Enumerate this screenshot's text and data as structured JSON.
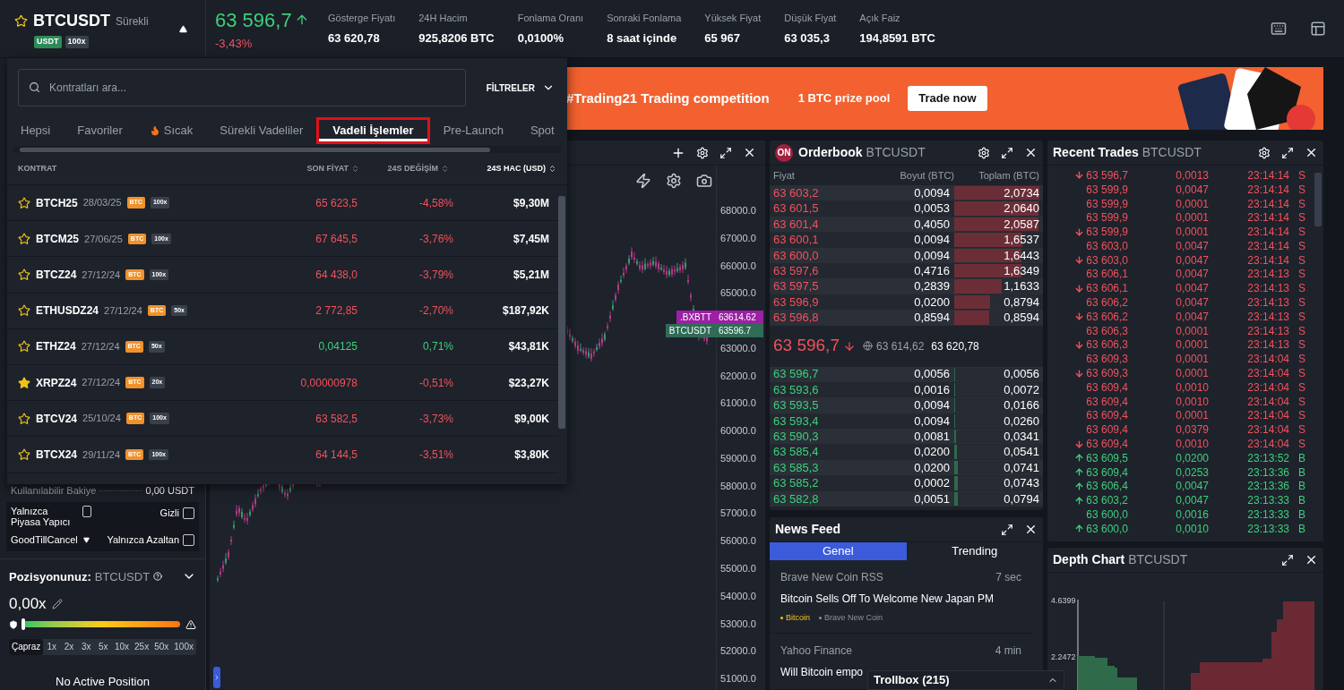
{
  "header": {
    "symbol": "BTCUSDT",
    "type": "Sürekli",
    "favorite": false,
    "tags": [
      {
        "label": "USDT",
        "kind": "quote"
      },
      {
        "label": "100x",
        "kind": "leverage"
      }
    ],
    "last_price": "63 596,7",
    "price_up": true,
    "change": "-3,43%",
    "change_positive": false,
    "stats": [
      {
        "label": "Gösterge Fiyatı",
        "value": "63 620,78"
      },
      {
        "label": "24H Hacim",
        "value": "925,8206 BTC"
      },
      {
        "label": "Fonlama Oranı",
        "value": "0,0100%"
      },
      {
        "label": "Sonraki Fonlama",
        "value": "8 saat içinde"
      },
      {
        "label": "Yüksek Fiyat",
        "value": "65 967"
      },
      {
        "label": "Düşük Fiyat",
        "value": "63 035,3"
      },
      {
        "label": "Açık Faiz",
        "value": "194,8591 BTC"
      }
    ]
  },
  "contract_menu": {
    "search": {
      "placeholder": "Kontratları ara..."
    },
    "filter_label": "FİLTRELER",
    "tabs": [
      {
        "label": "Hepsi",
        "selected": false,
        "hot": false
      },
      {
        "label": "Favoriler",
        "selected": false,
        "hot": false
      },
      {
        "label": "Sıcak",
        "selected": false,
        "hot": true
      },
      {
        "label": "Sürekli Vadeliler",
        "selected": false,
        "hot": false
      },
      {
        "label": "Vadeli İşlemler",
        "selected": true,
        "hot": false
      },
      {
        "label": "Pre-Launch",
        "selected": false,
        "hot": false
      },
      {
        "label": "Spot",
        "selected": false,
        "hot": false
      }
    ],
    "columns": [
      {
        "label": "KONTRAT",
        "sortable": false,
        "active": false
      },
      {
        "label": "SON FİYAT",
        "sortable": true,
        "active": false
      },
      {
        "label": "24S DEĞİŞİM",
        "sortable": true,
        "active": false
      },
      {
        "label": "24S HAC (USD)",
        "sortable": true,
        "active": true
      }
    ],
    "rows": [
      {
        "symbol": "BTCH25",
        "date": "28/03/25",
        "tags": [
          "BTC",
          "100x"
        ],
        "favorite": false,
        "price": "65 623,5",
        "change": "-4,58%",
        "volume": "$9,30M",
        "positive": false
      },
      {
        "symbol": "BTCM25",
        "date": "27/06/25",
        "tags": [
          "BTC",
          "100x"
        ],
        "favorite": false,
        "price": "67 645,5",
        "change": "-3,76%",
        "volume": "$7,45M",
        "positive": false
      },
      {
        "symbol": "BTCZ24",
        "date": "27/12/24",
        "tags": [
          "BTC",
          "100x"
        ],
        "favorite": false,
        "price": "64 438,0",
        "change": "-3,79%",
        "volume": "$5,21M",
        "positive": false
      },
      {
        "symbol": "ETHUSDZ24",
        "date": "27/12/24",
        "tags": [
          "BTC",
          "50x"
        ],
        "favorite": false,
        "price": "2 772,85",
        "change": "-2,70%",
        "volume": "$187,92K",
        "positive": false
      },
      {
        "symbol": "ETHZ24",
        "date": "27/12/24",
        "tags": [
          "BTC",
          "50x"
        ],
        "favorite": false,
        "price": "0,04125",
        "change": "0,71%",
        "volume": "$43,81K",
        "positive": true
      },
      {
        "symbol": "XRPZ24",
        "date": "27/12/24",
        "tags": [
          "BTC",
          "20x"
        ],
        "favorite": true,
        "price": "0,00000978",
        "change": "-0,51%",
        "volume": "$23,27K",
        "positive": false
      },
      {
        "symbol": "BTCV24",
        "date": "25/10/24",
        "tags": [
          "BTC",
          "100x"
        ],
        "favorite": false,
        "price": "63 582,5",
        "change": "-3,73%",
        "volume": "$9,00K",
        "positive": false
      },
      {
        "symbol": "BTCX24",
        "date": "29/11/24",
        "tags": [
          "BTC",
          "100x"
        ],
        "favorite": false,
        "price": "64 144,5",
        "change": "-3,51%",
        "volume": "$3,80K",
        "positive": false
      }
    ]
  },
  "banner": {
    "title": "#Trading21 Trading competition",
    "subtitle": "1 BTC prize pool",
    "button": "Trade now"
  },
  "order_form": {
    "balance_label": "Kullanılabilir Bakiye",
    "balance_value": "0,00 USDT",
    "time_in_force": "GoodTillCancel",
    "options": [
      {
        "label": "Yalnızca Piyasa Yapıcı",
        "checked": false
      },
      {
        "label": "Gizli",
        "checked": false
      },
      {
        "label": "Yalnızca Azaltan",
        "checked": false
      }
    ]
  },
  "position": {
    "title": "Pozisyonunuz:",
    "symbol": "BTCUSDT",
    "leverage": "0,00x",
    "level": 0,
    "status": "No Active Position",
    "leverage_options": [
      {
        "label": "Çapraz",
        "selected": true
      },
      {
        "label": "1x",
        "selected": false
      },
      {
        "label": "2x",
        "selected": false
      },
      {
        "label": "3x",
        "selected": false
      },
      {
        "label": "5x",
        "selected": false
      },
      {
        "label": "10x",
        "selected": false
      },
      {
        "label": "25x",
        "selected": false
      },
      {
        "label": "50x",
        "selected": false
      },
      {
        "label": "100x",
        "selected": false
      }
    ]
  },
  "chart": {
    "y_axis": [
      "68000.0",
      "67000.0",
      "66000.0",
      "65000.0",
      "63000.0",
      "62000.0",
      "61000.0",
      "60000.0",
      "59000.0",
      "58000.0",
      "57000.0",
      "56000.0",
      "55000.0",
      "54000.0",
      "53000.0",
      "52000.0",
      "51000.0"
    ],
    "price_tags": [
      {
        "symbol": ".BXBTT",
        "price": "63614.62",
        "color": "#9c1fa5"
      },
      {
        "symbol": "BTCUSDT",
        "price": "63596.7",
        "color": "#2f6b55"
      }
    ]
  },
  "orderbook": {
    "badge": "ON",
    "title": "Orderbook",
    "symbol": "BTCUSDT",
    "columns": [
      "Fiyat",
      "Boyut (BTC)",
      "Toplam (BTC)"
    ],
    "asks": [
      {
        "price": "63 603,2",
        "size": "0,0094",
        "total": "2,0734",
        "level": 1
      },
      {
        "price": "63 601,5",
        "size": "0,0053",
        "total": "2,0640",
        "level": 0.99
      },
      {
        "price": "63 601,4",
        "size": "0,4050",
        "total": "2,0587",
        "level": 0.99
      },
      {
        "price": "63 600,1",
        "size": "0,0094",
        "total": "1,6537",
        "level": 0.8
      },
      {
        "price": "63 600,0",
        "size": "0,0094",
        "total": "1,6443",
        "level": 0.79
      },
      {
        "price": "63 597,6",
        "size": "0,4716",
        "total": "1,6349",
        "level": 0.79
      },
      {
        "price": "63 597,5",
        "size": "0,2839",
        "total": "1,1633",
        "level": 0.56
      },
      {
        "price": "63 596,9",
        "size": "0,0200",
        "total": "0,8794",
        "level": 0.42
      },
      {
        "price": "63 596,8",
        "size": "0,8594",
        "total": "0,8594",
        "level": 0.41
      }
    ],
    "mid": {
      "price": "63 596,7",
      "price_up": false,
      "index": "63 614,62",
      "mark": "63 620,78"
    },
    "bids": [
      {
        "price": "63 596,7",
        "size": "0,0056",
        "total": "0,0056",
        "level": 0.01
      },
      {
        "price": "63 593,6",
        "size": "0,0016",
        "total": "0,0072",
        "level": 0.01
      },
      {
        "price": "63 593,5",
        "size": "0,0094",
        "total": "0,0166",
        "level": 0.01
      },
      {
        "price": "63 593,4",
        "size": "0,0094",
        "total": "0,0260",
        "level": 0.01
      },
      {
        "price": "63 590,3",
        "size": "0,0081",
        "total": "0,0341",
        "level": 0.02
      },
      {
        "price": "63 585,4",
        "size": "0,0200",
        "total": "0,0541",
        "level": 0.03
      },
      {
        "price": "63 585,3",
        "size": "0,0200",
        "total": "0,0741",
        "level": 0.04
      },
      {
        "price": "63 585,2",
        "size": "0,0002",
        "total": "0,0743",
        "level": 0.04
      },
      {
        "price": "63 582,8",
        "size": "0,0051",
        "total": "0,0794",
        "level": 0.04
      }
    ]
  },
  "recent_trades": {
    "title": "Recent Trades",
    "symbol": "BTCUSDT",
    "rows": [
      {
        "price": "63 596,7",
        "size": "0,0013",
        "time": "23:14:14",
        "side": "S",
        "buy": false,
        "arrow": true
      },
      {
        "price": "63 599,9",
        "size": "0,0047",
        "time": "23:14:14",
        "side": "S",
        "buy": false,
        "arrow": false
      },
      {
        "price": "63 599,9",
        "size": "0,0001",
        "time": "23:14:14",
        "side": "S",
        "buy": false,
        "arrow": false
      },
      {
        "price": "63 599,9",
        "size": "0,0001",
        "time": "23:14:14",
        "side": "S",
        "buy": false,
        "arrow": false
      },
      {
        "price": "63 599,9",
        "size": "0,0001",
        "time": "23:14:14",
        "side": "S",
        "buy": false,
        "arrow": true
      },
      {
        "price": "63 603,0",
        "size": "0,0047",
        "time": "23:14:14",
        "side": "S",
        "buy": false,
        "arrow": false
      },
      {
        "price": "63 603,0",
        "size": "0,0047",
        "time": "23:14:14",
        "side": "S",
        "buy": false,
        "arrow": true
      },
      {
        "price": "63 606,1",
        "size": "0,0047",
        "time": "23:14:13",
        "side": "S",
        "buy": false,
        "arrow": false
      },
      {
        "price": "63 606,1",
        "size": "0,0047",
        "time": "23:14:13",
        "side": "S",
        "buy": false,
        "arrow": true
      },
      {
        "price": "63 606,2",
        "size": "0,0047",
        "time": "23:14:13",
        "side": "S",
        "buy": false,
        "arrow": false
      },
      {
        "price": "63 606,2",
        "size": "0,0047",
        "time": "23:14:13",
        "side": "S",
        "buy": false,
        "arrow": true
      },
      {
        "price": "63 606,3",
        "size": "0,0001",
        "time": "23:14:13",
        "side": "S",
        "buy": false,
        "arrow": false
      },
      {
        "price": "63 606,3",
        "size": "0,0001",
        "time": "23:14:13",
        "side": "S",
        "buy": false,
        "arrow": true
      },
      {
        "price": "63 609,3",
        "size": "0,0001",
        "time": "23:14:04",
        "side": "S",
        "buy": false,
        "arrow": false
      },
      {
        "price": "63 609,3",
        "size": "0,0001",
        "time": "23:14:04",
        "side": "S",
        "buy": false,
        "arrow": true
      },
      {
        "price": "63 609,4",
        "size": "0,0010",
        "time": "23:14:04",
        "side": "S",
        "buy": false,
        "arrow": false
      },
      {
        "price": "63 609,4",
        "size": "0,0010",
        "time": "23:14:04",
        "side": "S",
        "buy": false,
        "arrow": false
      },
      {
        "price": "63 609,4",
        "size": "0,0001",
        "time": "23:14:04",
        "side": "S",
        "buy": false,
        "arrow": false
      },
      {
        "price": "63 609,4",
        "size": "0,0379",
        "time": "23:14:04",
        "side": "S",
        "buy": false,
        "arrow": false
      },
      {
        "price": "63 609,4",
        "size": "0,0010",
        "time": "23:14:04",
        "side": "S",
        "buy": false,
        "arrow": true
      },
      {
        "price": "63 609,5",
        "size": "0,0200",
        "time": "23:13:52",
        "side": "B",
        "buy": true,
        "arrow": true
      },
      {
        "price": "63 609,4",
        "size": "0,0253",
        "time": "23:13:36",
        "side": "B",
        "buy": true,
        "arrow": true
      },
      {
        "price": "63 606,4",
        "size": "0,0047",
        "time": "23:13:36",
        "side": "B",
        "buy": true,
        "arrow": true
      },
      {
        "price": "63 603,2",
        "size": "0,0047",
        "time": "23:13:33",
        "side": "B",
        "buy": true,
        "arrow": true
      },
      {
        "price": "63 600,0",
        "size": "0,0016",
        "time": "23:13:33",
        "side": "B",
        "buy": true,
        "arrow": false
      },
      {
        "price": "63 600,0",
        "size": "0,0010",
        "time": "23:13:33",
        "side": "B",
        "buy": true,
        "arrow": true
      }
    ]
  },
  "news_feed": {
    "title": "News Feed",
    "tabs": [
      {
        "label": "Genel",
        "selected": true
      },
      {
        "label": "Trending",
        "selected": false
      }
    ],
    "items": [
      {
        "source": "Brave New Coin RSS",
        "time": "7 sec",
        "title": "Bitcoin Sells Off To Welcome New Japan PM",
        "tags": [
          {
            "label": "Bitcoin",
            "color": "#f0c419"
          },
          {
            "label": "Brave New Coin",
            "color": "#8b929c"
          }
        ]
      },
      {
        "source": "Yahoo Finance",
        "time": "4 min",
        "title": "Will Bitcoin empo"
      }
    ]
  },
  "depth_chart": {
    "title": "Depth Chart",
    "symbol": "BTCUSDT",
    "y_labels": [
      "4.6399",
      "2.2472"
    ]
  },
  "trollbox": {
    "title": "Trollbox (215)"
  }
}
